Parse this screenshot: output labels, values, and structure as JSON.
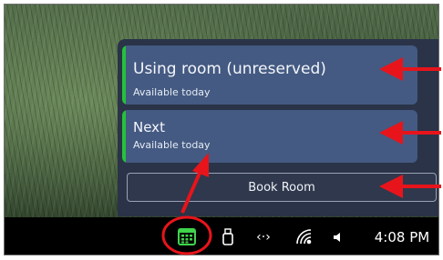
{
  "flyout": {
    "current": {
      "title": "Using room (unreserved)",
      "subtitle": "Available today"
    },
    "next": {
      "title": "Next",
      "subtitle": "Available today"
    },
    "book_button_label": "Book Room"
  },
  "taskbar": {
    "clock": "4:08 PM",
    "icons": [
      "calendar-icon",
      "usb-icon",
      "network-icon",
      "wifi-icon",
      "volume-icon"
    ]
  },
  "colors": {
    "flyout_bg": "#2a3347",
    "card_bg": "#445a82",
    "status_accent": "#25c23b",
    "annotation": "#e8141b"
  }
}
